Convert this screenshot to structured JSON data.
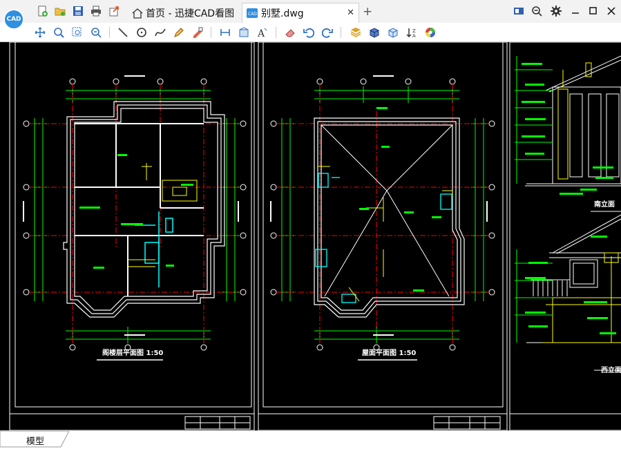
{
  "app": {
    "logo_text": "CAD"
  },
  "tabs": [
    {
      "label": "首页 - 迅捷CAD看图"
    },
    {
      "label": "别墅.dwg"
    }
  ],
  "drawing": {
    "titles": [
      "阁楼层平面图 1:50",
      "屋面平面图 1:50",
      "南立面",
      "西立面"
    ]
  },
  "status": {
    "model_tab": "模型"
  },
  "colors": {
    "canvas_bg": "#000000",
    "accent": "#2f8fe0",
    "wall": "#ffffff",
    "axis": "#ff0000",
    "dimension": "#00ff00",
    "text": "#ffff00",
    "cyan": "#00ffff"
  }
}
